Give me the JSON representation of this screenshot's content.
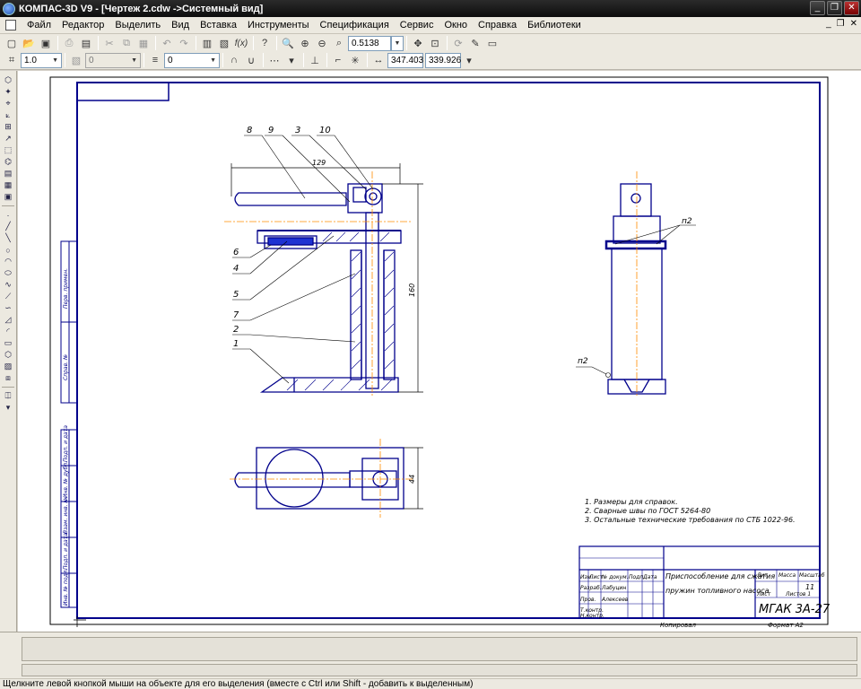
{
  "window": {
    "title": "КОМПАС-3D V9 - [Чертеж 2.cdw ->Системный вид]"
  },
  "menu": [
    "Файл",
    "Редактор",
    "Выделить",
    "Вид",
    "Вставка",
    "Инструменты",
    "Спецификация",
    "Сервис",
    "Окно",
    "Справка",
    "Библиотеки"
  ],
  "toolbar": {
    "zoom_value": "0.5138",
    "cursor_x": "347.403",
    "cursor_y": "339.926"
  },
  "props_toolbar": {
    "line_scale": "1.0",
    "layer_disabled": "0",
    "step": "0"
  },
  "drawing": {
    "leaders": [
      "8",
      "9",
      "3",
      "10",
      "6",
      "4",
      "5",
      "7",
      "2",
      "1"
    ],
    "dim_length": "129",
    "dim_height": "160",
    "dim_width": "44",
    "weld_side_label": "п2",
    "weld_bottom_label": "п2",
    "notes": [
      "1. Размеры для справок.",
      "2. Сварные швы по ГОСТ 5264-80",
      "3. Остальные технические требования по СТБ 1022-96."
    ],
    "title_block": {
      "name_line1": "Приспособление для сжатия",
      "name_line2": "пружин топливного насоса",
      "org": "МГАК 3А-27",
      "sheets": "11",
      "sheet": "Лист",
      "sheets_label": "Листов 1",
      "copied": "Копировал",
      "format": "Формат А2",
      "header_lit": "Лит.",
      "header_mass": "Масса",
      "header_scale": "Масштаб",
      "row_labels": [
        "Изм.",
        "Лист",
        "№ докум.",
        "Подп.",
        "Дата",
        "Разраб.",
        "Пров.",
        "Т.контр.",
        "Н.контр.",
        "Утв."
      ],
      "names": [
        "Лабуцин",
        "Алексеев"
      ]
    },
    "side_stamp_labels": [
      "Перв. примен.",
      "Справ. №",
      "Подп. и дата",
      "Инв. № дубл.",
      "Взам. инв. №",
      "Подп. и дата",
      "Инв. № подл."
    ]
  },
  "statusbar": {
    "hint": "Щелкните левой кнопкой мыши на объекте для его выделения (вместе с Ctrl или Shift - добавить к выделенным)"
  }
}
